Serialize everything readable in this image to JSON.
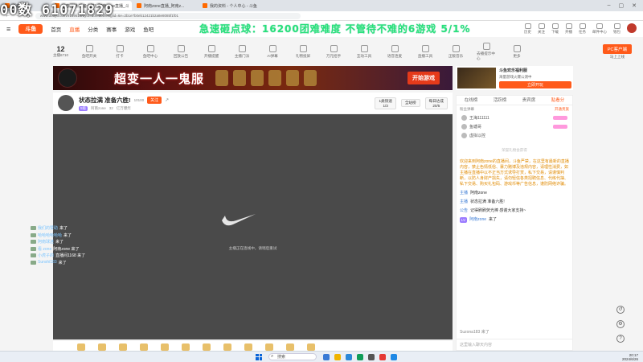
{
  "overlay": {
    "counter": "00数 61071829",
    "banner": "急速砸点球：16200团难难度 不管待不难的6游戏 5/1%"
  },
  "browser": {
    "tabs": [
      {
        "label": "新标签页"
      },
      {
        "label": "状态拉满 准备六胜!_阿南zone直播_斗鱼"
      },
      {
        "label": "阿南zone直播_阿南z..."
      },
      {
        "label": "我的资料 - 个人中心 - 斗鱼"
      }
    ],
    "url": "www.douyu.com/9159616/dyto=dot=dotheisgiid=6e=2b1e7b0eb12421b2a8e8085f1f01"
  },
  "site": {
    "logo": "斗鱼",
    "nav": [
      "首页",
      "直播",
      "分类",
      "赛事",
      "游戏",
      "鱼吧"
    ],
    "header_right": [
      "历史",
      "关注",
      "下载",
      "开播",
      "任务",
      "邮件中心",
      "钱包"
    ]
  },
  "tools": {
    "level_value": "12",
    "level_label": "主播6710",
    "items": [
      "鱼吧开关",
      "打卡",
      "鱼吧中心",
      "回放公告",
      "开播提醒",
      "主播门派",
      "AI弹幕",
      "礼物投屏",
      "万元招手",
      "互动工具",
      "语音连麦",
      "直播工具",
      "正版音乐",
      "去播提示中心",
      "更多"
    ],
    "pc_button": "PC客户端",
    "pc_sub": "马上上线"
  },
  "ad": {
    "title": "超变一人一鬼服",
    "play_button": "开始游戏",
    "side_title": "斗鱼欢乐福利服",
    "side_text": "海量游戏火爆公测中",
    "side_button": "立即开玩"
  },
  "room": {
    "title": "状态拉满 准备六胜!",
    "follow_count": "10100",
    "follow": "关注",
    "streamer": "阿南zone",
    "tag": "5级",
    "viewers": "32",
    "category": "亿万爆炸",
    "stat1_label": "1类快速",
    "stat1_value": "1/3",
    "stat2": "全站榜",
    "stat3_label": "每日达成",
    "stat3_value": "20/5"
  },
  "video": {
    "loading_text": "主播正在连线中，请稍后重试"
  },
  "float_chat": [
    {
      "name": "我们的赞助",
      "text": "来了"
    },
    {
      "name": "哈哈哈哈哈哈",
      "text": "来了"
    },
    {
      "name": "阿南球迷",
      "text": "来了"
    },
    {
      "name": "看 zone",
      "text": "阿南zone 来了"
    },
    {
      "name": "小虎子的",
      "text": "直播间1168 来了"
    },
    {
      "name": "Sunshi183",
      "text": "来了"
    }
  ],
  "chat": {
    "tabs": [
      "在线榜",
      "活跃榜",
      "贵宾席",
      "贴看分"
    ],
    "rank_header_left": "粉丝弹幕",
    "rank_header_right": "开通贵族",
    "rank": [
      {
        "name": "王海111111"
      },
      {
        "name": "鱼塘哥"
      },
      {
        "name": "虚拟以控"
      }
    ],
    "gift_note": "荣誉礼物会获得",
    "system_message": "欢迎来到阿南zone的直播间，斗鱼严禁，在这里有最新的直播内容，禁止色情低俗、暴力赌博及违规内容，请理性消费，如主播在直播中以不正当方式诱导打赏，私下交易，请谨慎判断，以防人身财产损失，请勿轻信各类招聘信息、代练代抽、私下交易、购买礼包码、游戏币等广告信息，谨防网络诈骗。",
    "messages": [
      {
        "user": "主播",
        "text": "阿南zone"
      },
      {
        "user": "主播",
        "text": "状态拉满 准备六胜!"
      },
      {
        "user": "公告",
        "text": "记得刷刷荧光棒 感谢大家支持~"
      },
      {
        "user": "阿南zone",
        "text": "来了"
      }
    ],
    "bottom_line": "Suzona183 来了",
    "input_placeholder": "这里输入聊天内容"
  },
  "taskbar": {
    "search": "搜索",
    "time": "20:17",
    "date": "2024/6/26"
  }
}
